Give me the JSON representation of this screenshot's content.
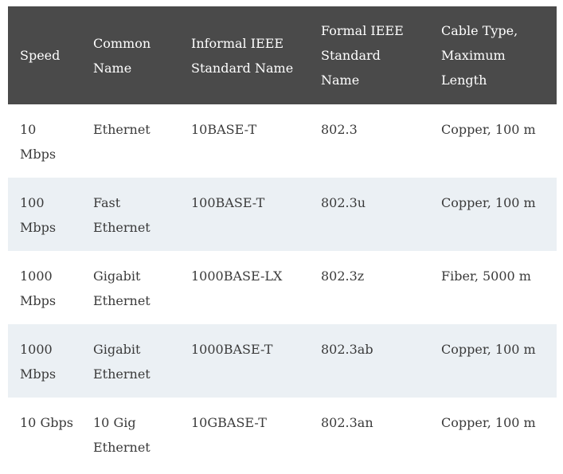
{
  "table": {
    "headers": [
      "Speed",
      "Common Name",
      "Informal IEEE Standard Name",
      "Formal IEEE Standard Name",
      "Cable Type, Maximum Length"
    ],
    "rows": [
      [
        "10 Mbps",
        "Ethernet",
        "10BASE-T",
        "802.3",
        "Copper, 100 m"
      ],
      [
        "100 Mbps",
        "Fast Ethernet",
        "100BASE-T",
        "802.3u",
        "Copper, 100 m"
      ],
      [
        "1000 Mbps",
        "Gigabit Ethernet",
        "1000BASE-LX",
        "802.3z",
        "Fiber, 5000 m"
      ],
      [
        "1000 Mbps",
        "Gigabit Ethernet",
        "1000BASE-T",
        "802.3ab",
        "Copper, 100 m"
      ],
      [
        "10 Gbps",
        "10 Gig Ethernet",
        "10GBASE-T",
        "802.3an",
        "Copper, 100 m"
      ]
    ]
  },
  "colors": {
    "header_bg": "#4a4a4a",
    "header_text": "#ffffff",
    "stripe_bg": "#ebf0f4",
    "body_text": "#3a3a3a"
  }
}
